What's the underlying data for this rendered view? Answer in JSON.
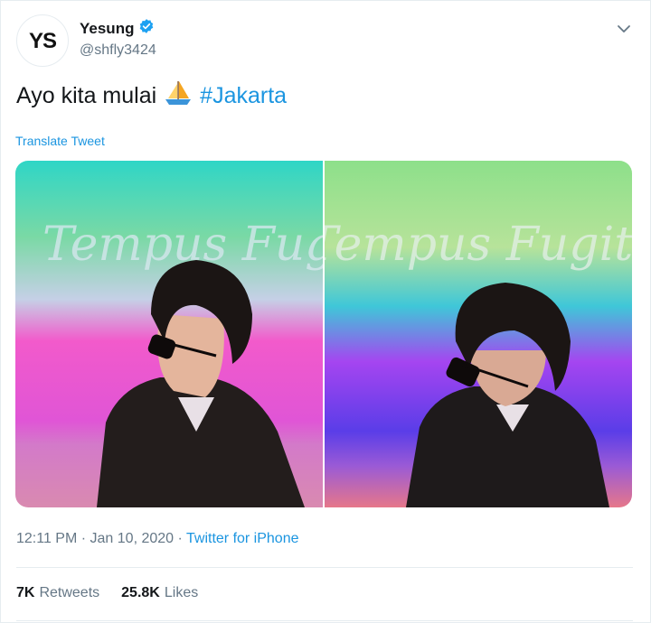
{
  "user": {
    "display_name": "Yesung",
    "handle": "@shfly3424",
    "avatar_text": "YS",
    "verified": true
  },
  "tweet": {
    "text": "Ayo kita mulai",
    "emoji": "⛵",
    "hashtag": "#Jakarta",
    "translate_label": "Translate Tweet"
  },
  "media": {
    "count": 2,
    "photo_1_text": "Tempus Fugit, Amor Manet",
    "photo_2_text": "Tempus Fugit, Amor Manet"
  },
  "meta": {
    "time": "12:11 PM",
    "separator": "·",
    "date": "Jan 10, 2020",
    "source": "Twitter for iPhone"
  },
  "stats": {
    "retweets_count": "7K",
    "retweets_label": "Retweets",
    "likes_count": "25.8K",
    "likes_label": "Likes"
  },
  "colors": {
    "link": "#1b95e0",
    "verified": "#1da1f2",
    "text": "#14171a",
    "secondary": "#657786"
  },
  "icons": [
    "verified-badge-icon",
    "chevron-down-icon",
    "sailboat-emoji"
  ]
}
